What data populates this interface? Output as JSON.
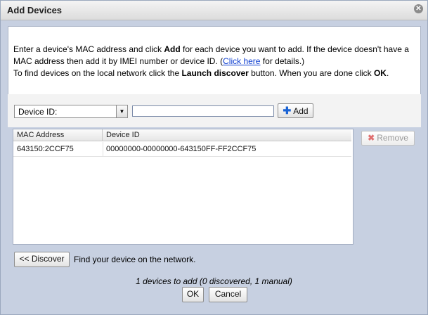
{
  "dialog": {
    "title": "Add Devices",
    "close_icon": "close-icon"
  },
  "info": {
    "line1_pre": "Enter a device's MAC address and click ",
    "line1_bold": "Add",
    "line1_post": " for each device you want to add. If the device doesn't have a",
    "line2_pre": "MAC address then add it by IMEI number or device ID. (",
    "line2_link": "Click here",
    "line2_post": " for details.)",
    "line3_pre": "To find devices on the local network click the ",
    "line3_bold": "Launch discover",
    "line3_mid": " button. When you are done click ",
    "line3_bold2": "OK",
    "line3_post": "."
  },
  "input_bar": {
    "id_type_selected": "Device ID:",
    "id_value": "",
    "add_label": "Add"
  },
  "table": {
    "columns": [
      "MAC Address",
      "Device ID"
    ],
    "rows": [
      {
        "mac": "643150:2CCF75",
        "device_id": "00000000-00000000-643150FF-FF2CCF75"
      }
    ]
  },
  "remove_label": "Remove",
  "discover": {
    "button_label": "<< Discover",
    "hint": "Find your device on the network."
  },
  "summary": "1 devices to add (0 discovered, 1 manual)",
  "footer": {
    "ok_label": "OK",
    "cancel_label": "Cancel"
  },
  "colors": {
    "dialog_bg": "#c7d0e1",
    "link": "#0b3ccf",
    "add_icon": "#1a63d4",
    "remove_icon": "#e07070"
  }
}
